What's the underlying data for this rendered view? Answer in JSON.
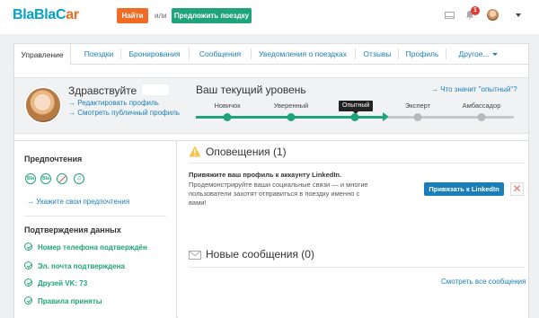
{
  "header": {
    "logo": "BlaBlaCar",
    "find_label": "Найти",
    "or_label": "или",
    "offer_label": "Предложить поездку",
    "notification_count": "1"
  },
  "tabs": [
    {
      "label": "Управление"
    },
    {
      "label": "Поездки"
    },
    {
      "label": "Бронирования"
    },
    {
      "label": "Сообщения"
    },
    {
      "label": "Уведомления о поездках"
    },
    {
      "label": "Отзывы"
    },
    {
      "label": "Профиль"
    },
    {
      "label": "Другое..."
    }
  ],
  "profile": {
    "greeting": "Здравствуйте",
    "edit_link": "→ Редактировать профиль",
    "public_link": "→ Смотреть публичный профиль"
  },
  "level": {
    "title": "Ваш текущий уровень",
    "help_link": "→ Что значит \"опытный\"?",
    "current": "Опытный",
    "steps": [
      "Новичок",
      "Уверенный",
      "Опытный",
      "Эксперт",
      "Амбассадор"
    ],
    "current_index": 2
  },
  "preferences": {
    "title": "Предпочтения",
    "icons": [
      "Bla",
      "Bla",
      "no-smoking",
      "music"
    ],
    "set_link": "→ Укажите свои предпочтения"
  },
  "verifications": {
    "title": "Подтверждения данных",
    "items": [
      "Номер телефона подтверждён",
      "Эл. почта подтверждена",
      "Друзей VK: 73",
      "Правила приняты"
    ]
  },
  "notifications": {
    "title": "Оповещения (1)",
    "linkedin_title": "Привяжите ваш профиль к аккаунту LinkedIn.",
    "linkedin_text": "Продемонстрируйте ваши социальные связи — и многие пользователи захотят отправиться в поездку именно с вами!",
    "linkedin_button": "Привязать к LinkedIn",
    "close": "✕"
  },
  "messages": {
    "title": "Новые сообщения (0)",
    "all_link": "Смотреть все сообщения"
  },
  "colors": {
    "brand_blue": "#00a2c7",
    "orange": "#f06b24",
    "green": "#1fa37a",
    "link": "#1a7fb8",
    "badge_red": "#e53935"
  }
}
